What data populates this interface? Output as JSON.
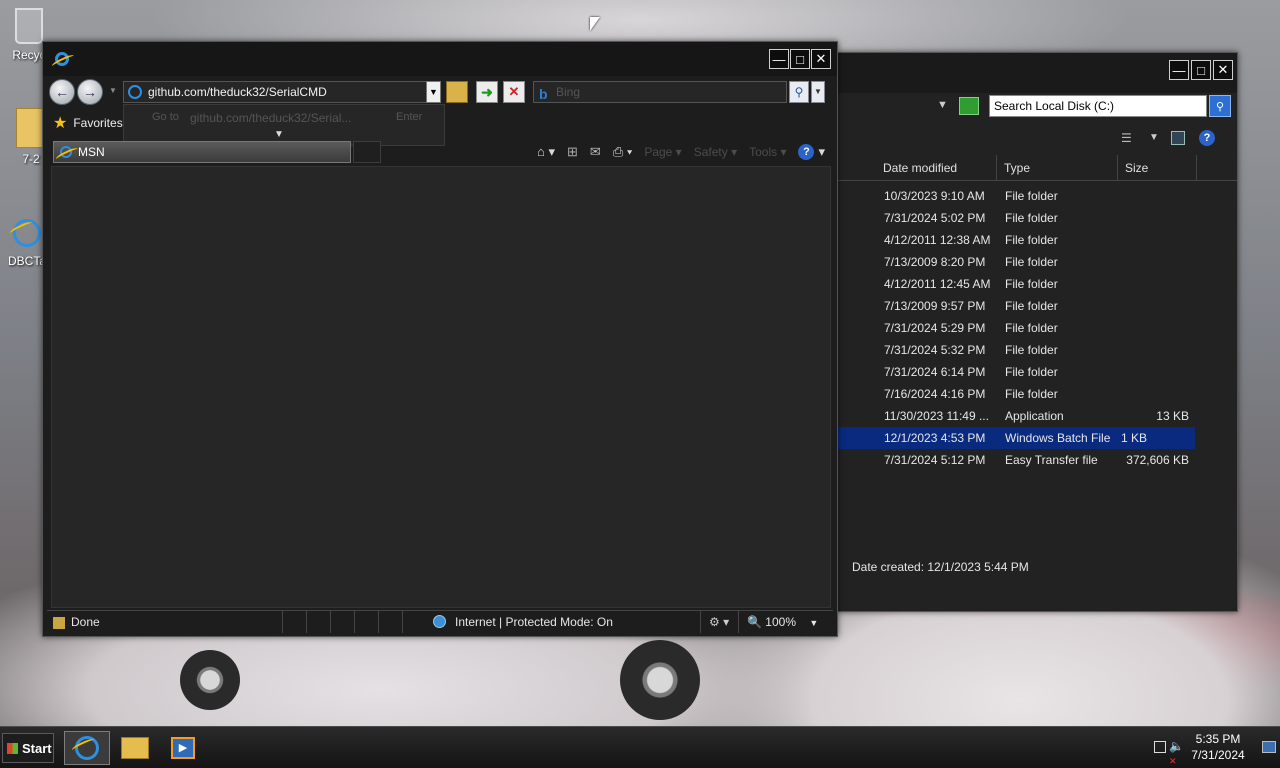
{
  "desktop": {
    "icons": [
      {
        "label": "Recyc"
      },
      {
        "label": "7-2"
      },
      {
        "label": "DBCTa"
      }
    ]
  },
  "explorer": {
    "search_placeholder": "Search Local Disk (C:)",
    "columns": {
      "date": "Date modified",
      "type": "Type",
      "size": "Size"
    },
    "rows": [
      {
        "date": "10/3/2023 9:10 AM",
        "type": "File folder",
        "size": ""
      },
      {
        "date": "7/31/2024 5:02 PM",
        "type": "File folder",
        "size": ""
      },
      {
        "date": "4/12/2011 12:38 AM",
        "type": "File folder",
        "size": ""
      },
      {
        "date": "7/13/2009 8:20 PM",
        "type": "File folder",
        "size": ""
      },
      {
        "date": "4/12/2011 12:45 AM",
        "type": "File folder",
        "size": ""
      },
      {
        "date": "7/13/2009 9:57 PM",
        "type": "File folder",
        "size": ""
      },
      {
        "date": "7/31/2024 5:29 PM",
        "type": "File folder",
        "size": ""
      },
      {
        "date": "7/31/2024 5:32 PM",
        "type": "File folder",
        "size": ""
      },
      {
        "date": "7/31/2024 6:14 PM",
        "type": "File folder",
        "size": ""
      },
      {
        "date": "7/16/2024 4:16 PM",
        "type": "File folder",
        "size": ""
      },
      {
        "date": "11/30/2023 11:49 ...",
        "type": "Application",
        "size": "13 KB"
      },
      {
        "date": "12/1/2023 4:53 PM",
        "type": "Windows Batch File",
        "size": "1 KB",
        "selected": true
      },
      {
        "date": "7/31/2024 5:12 PM",
        "type": "Easy Transfer file",
        "size": "372,606 KB"
      }
    ],
    "details": {
      "date_created": "Date created: 12/1/2023 5:44 PM"
    }
  },
  "ie": {
    "address": "github.com/theduck32/SerialCMD",
    "autocomplete": {
      "label": "Go to",
      "url": "github.com/theduck32/Serial...",
      "hint": "Enter"
    },
    "search_engine": "b",
    "search_placeholder": "Bing",
    "favorites_label": "Favorites",
    "tab_title": "MSN",
    "commands": {
      "page": "Page",
      "safety": "Safety",
      "tools": "Tools"
    },
    "status": {
      "text": "Done",
      "zone": "Internet | Protected Mode: On",
      "zoom": "100%"
    }
  },
  "taskbar": {
    "start_label": "Start",
    "time": "5:35 PM",
    "date": "7/31/2024"
  },
  "colors": {
    "selection": "#0a2a80",
    "ie_blue": "#2f8fe0",
    "go_green": "#2f9d2f"
  }
}
